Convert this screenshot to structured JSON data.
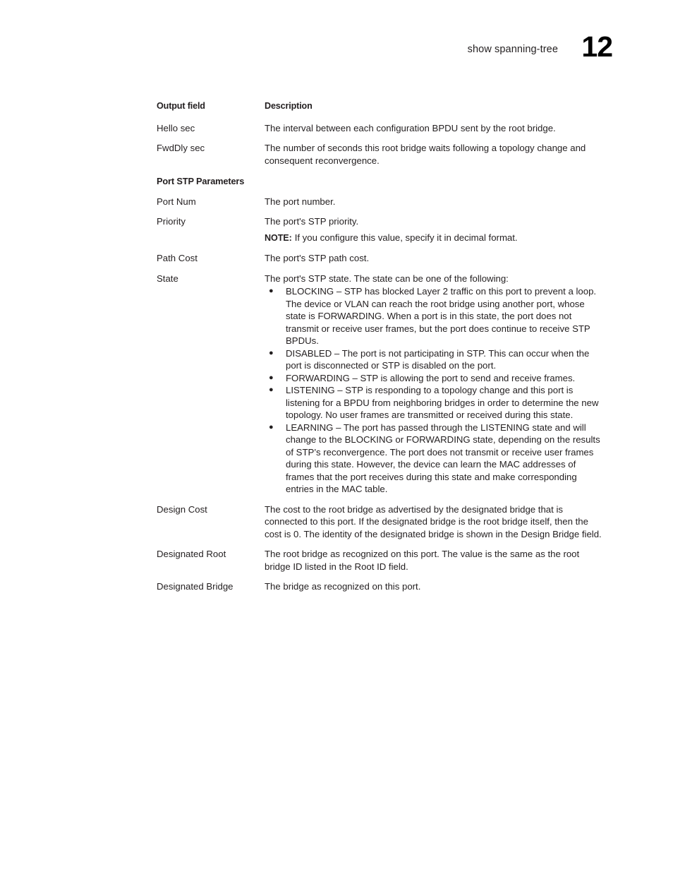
{
  "running_head": {
    "title": "show spanning-tree",
    "page_number": "12"
  },
  "table": {
    "headers": {
      "field": "Output field",
      "description": "Description"
    },
    "rows": [
      {
        "field": "Hello sec",
        "description": "The interval between each configuration BPDU sent by the root bridge."
      },
      {
        "field": "FwdDly sec",
        "description": "The number of seconds this root bridge waits following a topology change and consequent reconvergence."
      }
    ],
    "section_heading": "Port STP Parameters",
    "section_rows": [
      {
        "field": "Port Num",
        "description": "The port number."
      },
      {
        "field": "Priority",
        "description": "The port's STP priority.",
        "note_label": "NOTE:",
        "note_text": "If you configure this value, specify it in decimal format."
      },
      {
        "field": "Path Cost",
        "description": "The port's STP path cost."
      }
    ],
    "state_row": {
      "field": "State",
      "intro": "The port's STP state. The state can be one of the following:",
      "bullet_glyph": "●",
      "bullets": [
        "BLOCKING – STP has blocked Layer 2 traffic on this port to prevent a loop. The device or VLAN can reach the root bridge using another port, whose state is FORWARDING. When a port is in this state, the port does not transmit or receive user frames, but the port does continue to receive STP BPDUs.",
        "DISABLED – The port is not participating in STP. This can occur when the port is disconnected or STP is disabled on the port.",
        "FORWARDING – STP is allowing the port to send and receive frames.",
        "LISTENING – STP is responding to a topology change and this port is listening for a BPDU from neighboring bridges in order to determine the new topology. No user frames are transmitted or received during this state.",
        "LEARNING – The port has passed through the LISTENING state and will change to the BLOCKING or FORWARDING state, depending on the results of STP’s reconvergence. The port does not transmit or receive user frames during this state. However, the device can learn the MAC addresses of frames that the port receives during this state and make corresponding entries in the MAC table."
      ]
    },
    "trailing_rows": [
      {
        "field": "Design Cost",
        "description": "The cost to the root bridge as advertised by the designated bridge that is connected to this port. If the designated bridge is the root bridge itself, then the cost is 0. The identity of the designated bridge is shown in the Design Bridge field."
      },
      {
        "field": "Designated Root",
        "description": "The root bridge as recognized on this port. The value is the same as the root bridge ID listed in the Root ID field."
      },
      {
        "field": "Designated Bridge",
        "description": "The bridge as recognized on this port."
      }
    ]
  }
}
